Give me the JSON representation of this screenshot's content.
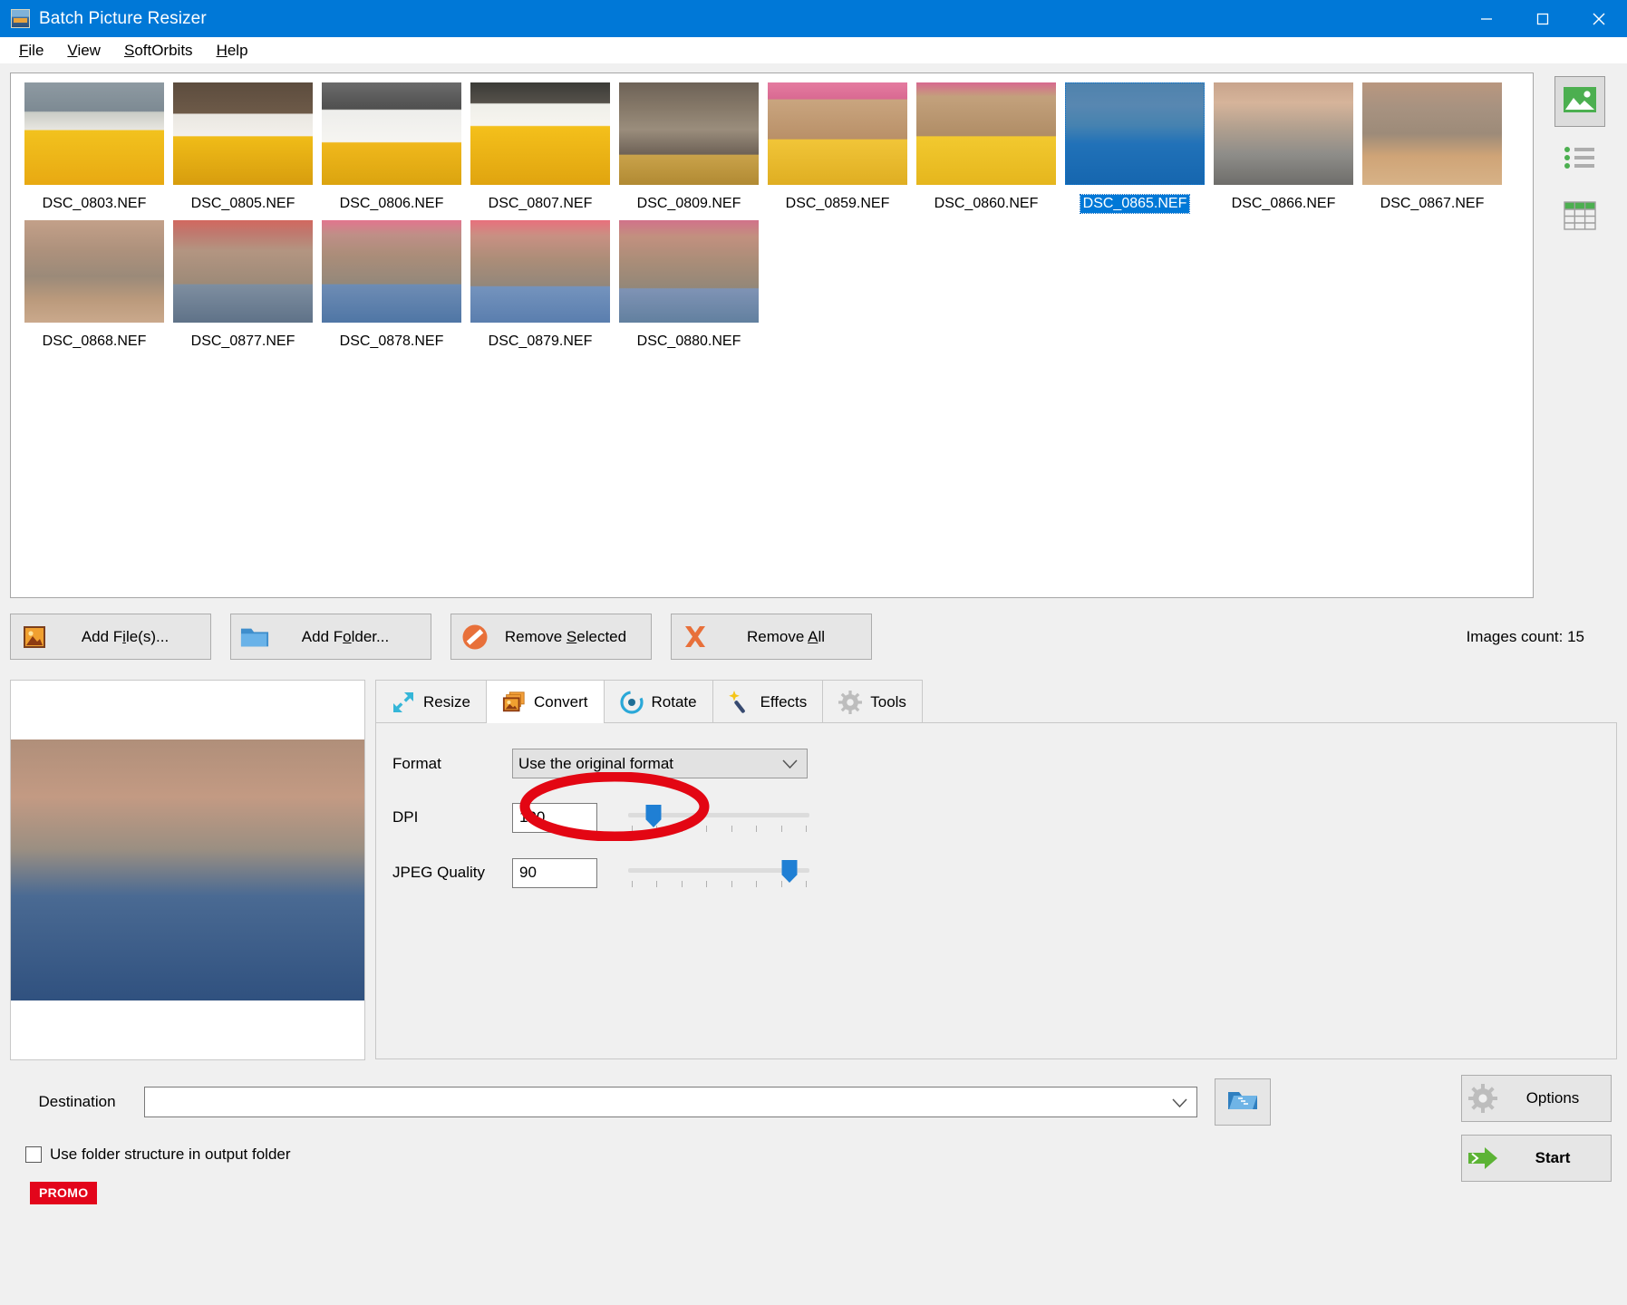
{
  "window": {
    "title": "Batch Picture Resizer",
    "icon": "app-icon",
    "minimize": "minimize-icon",
    "maximize": "maximize-icon",
    "close": "close-icon",
    "titlebar_color": "#0078d7"
  },
  "menu": [
    {
      "label": "File",
      "accel": "F"
    },
    {
      "label": "View",
      "accel": "V"
    },
    {
      "label": "SoftOrbits",
      "accel": "S"
    },
    {
      "label": "Help",
      "accel": "H"
    }
  ],
  "thumbnails": [
    {
      "label": "DSC_0803.NEF",
      "selected": false
    },
    {
      "label": "DSC_0805.NEF",
      "selected": false
    },
    {
      "label": "DSC_0806.NEF",
      "selected": false
    },
    {
      "label": "DSC_0807.NEF",
      "selected": false
    },
    {
      "label": "DSC_0809.NEF",
      "selected": false
    },
    {
      "label": "DSC_0859.NEF",
      "selected": false
    },
    {
      "label": "DSC_0860.NEF",
      "selected": false
    },
    {
      "label": "DSC_0865.NEF",
      "selected": true
    },
    {
      "label": "DSC_0866.NEF",
      "selected": false
    },
    {
      "label": "DSC_0867.NEF",
      "selected": false
    },
    {
      "label": "DSC_0868.NEF",
      "selected": false
    },
    {
      "label": "DSC_0877.NEF",
      "selected": false
    },
    {
      "label": "DSC_0878.NEF",
      "selected": false
    },
    {
      "label": "DSC_0879.NEF",
      "selected": false
    },
    {
      "label": "DSC_0880.NEF",
      "selected": false
    }
  ],
  "view_modes": [
    {
      "name": "thumbnails-view",
      "icon": "picture-icon",
      "active": true
    },
    {
      "name": "list-view",
      "icon": "list-icon",
      "active": false
    },
    {
      "name": "details-view",
      "icon": "table-icon",
      "active": false
    }
  ],
  "actions": {
    "add_files": "Add File(s)...",
    "add_folder": "Add Folder...",
    "remove_selected": "Remove Selected",
    "remove_all": "Remove All",
    "images_count": "Images count: 15"
  },
  "tabs": [
    {
      "label": "Resize",
      "icon": "resize-arrows-icon",
      "active": false
    },
    {
      "label": "Convert",
      "icon": "convert-images-icon",
      "active": true
    },
    {
      "label": "Rotate",
      "icon": "rotate-icon",
      "active": false
    },
    {
      "label": "Effects",
      "icon": "magic-wand-icon",
      "active": false
    },
    {
      "label": "Tools",
      "icon": "gear-icon",
      "active": false
    }
  ],
  "convert_panel": {
    "format_label": "Format",
    "format_value": "Use the original format",
    "format_options": [
      "Use the original format"
    ],
    "dpi_label": "DPI",
    "dpi_value": "100",
    "dpi_slider_percent": 14,
    "jpeg_label": "JPEG Quality",
    "jpeg_value": "90",
    "jpeg_slider_percent": 89
  },
  "destination": {
    "label": "Destination",
    "value": "",
    "placeholder": "",
    "browse_icon": "open-folder-icon"
  },
  "folder_structure": {
    "label": "Use folder structure in output folder",
    "checked": false
  },
  "buttons": {
    "options": "Options",
    "options_icon": "gear-icon",
    "start": "Start",
    "start_icon": "green-arrow-icon"
  },
  "promo": {
    "label": "PROMO",
    "color": "#e3051b"
  },
  "annotation": {
    "type": "red-ellipse",
    "target": "Convert",
    "color": "#e30613"
  }
}
